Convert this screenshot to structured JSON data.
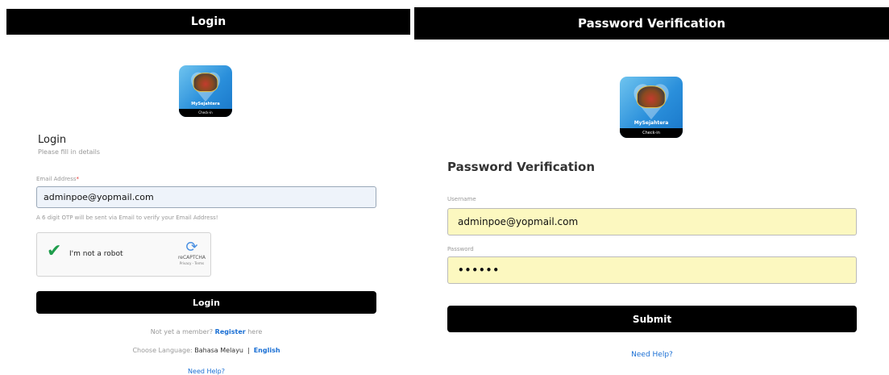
{
  "login": {
    "title": "Login",
    "logo": {
      "name": "MySejahtera",
      "strip": "Check-in"
    },
    "heading": "Login",
    "subtext": "Please fill in details",
    "email_label": "Email Address",
    "email_required": "*",
    "email_value": "adminpoe@yopmail.com",
    "otp_hint": "A 6 digit OTP will be sent via Email to verify your Email Address!",
    "captcha": {
      "label": "I'm not a robot",
      "brand": "reCAPTCHA",
      "terms": "Privacy - Terms",
      "checked": true
    },
    "login_button": "Login",
    "register_prefix": "Not yet a member?",
    "register_link": "Register",
    "register_suffix": "here",
    "language_label": "Choose Language:",
    "language_options": [
      "Bahasa Melayu",
      "English"
    ],
    "language_separator": "|",
    "need_help": "Need Help?"
  },
  "verify": {
    "title": "Password Verification",
    "logo": {
      "name": "MySejahtera",
      "strip": "Check-in"
    },
    "heading": "Password Verification",
    "username_label": "Username",
    "username_value": "adminpoe@yopmail.com",
    "password_label": "Password",
    "password_masked": "••••••",
    "submit_button": "Submit",
    "need_help": "Need Help?"
  },
  "colors": {
    "header_bg": "#000000",
    "link": "#1a6fd4",
    "autofill": "#fcf8c0",
    "email_field": "#eef3fa",
    "required": "#e53935",
    "captcha_check": "#1f9d4c"
  },
  "icons": [
    "app-logo-icon",
    "checkmark-icon",
    "recaptcha-icon"
  ]
}
